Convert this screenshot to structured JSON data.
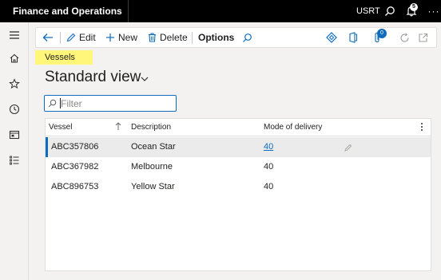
{
  "topbar": {
    "app_title": "Finance and Operations",
    "company": "USRT",
    "notification_count": "5",
    "more": "···"
  },
  "actions": {
    "edit": "Edit",
    "new": "New",
    "delete": "Delete",
    "options": "Options",
    "attachment_count": "0"
  },
  "breadcrumb": "Vessels",
  "page_title": "Standard view",
  "filter": {
    "placeholder": "Filter",
    "value": ""
  },
  "grid": {
    "columns": [
      "Vessel",
      "Description",
      "Mode of delivery"
    ],
    "rows": [
      {
        "vessel": "ABC357806",
        "description": "Ocean Star",
        "mode": "40",
        "selected": true
      },
      {
        "vessel": "ABC367982",
        "description": "Melbourne",
        "mode": "40",
        "selected": false
      },
      {
        "vessel": "ABC896753",
        "description": "Yellow Star",
        "mode": "40",
        "selected": false
      }
    ]
  },
  "colors": {
    "accent": "#0f6cbd",
    "breadcrumb_highlight": "#fff67a",
    "topbar": "#000000"
  }
}
